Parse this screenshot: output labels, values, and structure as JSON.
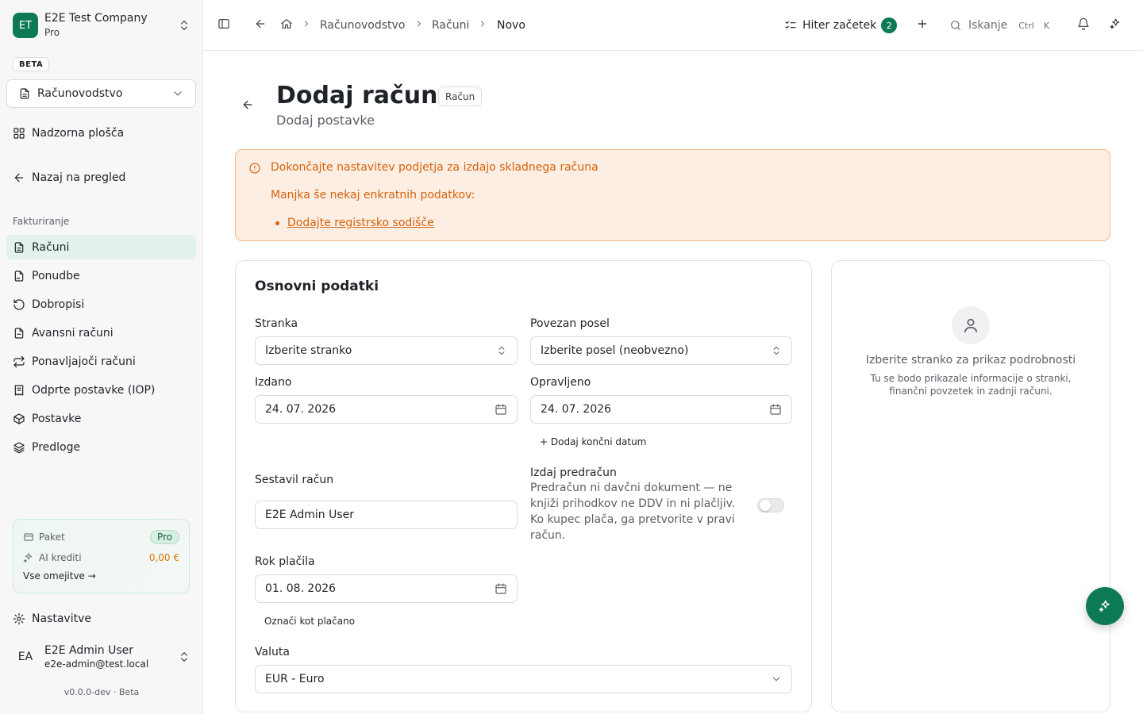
{
  "company": {
    "initials": "ET",
    "name": "E2E Test Company",
    "plan": "Pro"
  },
  "beta_label": "BETA",
  "module": {
    "selected": "Računovodstvo"
  },
  "nav": {
    "dashboard": "Nadzorna plošča",
    "back_overview": "Nazaj na pregled",
    "section": "Fakturiranje",
    "items": [
      {
        "label": "Računi",
        "icon": "file-text-icon"
      },
      {
        "label": "Ponudbe",
        "icon": "file-signature-icon"
      },
      {
        "label": "Dobropisi",
        "icon": "rotate-ccw-icon"
      },
      {
        "label": "Avansni računi",
        "icon": "file-minus-icon"
      },
      {
        "label": "Ponavljajoči računi",
        "icon": "repeat-icon"
      },
      {
        "label": "Odprte postavke (IOP)",
        "icon": "receipt-icon"
      },
      {
        "label": "Postavke",
        "icon": "package-icon"
      },
      {
        "label": "Predloge",
        "icon": "layers-icon"
      }
    ],
    "settings": "Nastavitve"
  },
  "plan_card": {
    "plan_label": "Paket",
    "plan_value": "Pro",
    "credits_label": "AI krediti",
    "credits_value": "0,00 €",
    "limits_link": "Vse omejitve →"
  },
  "user": {
    "initials": "EA",
    "name": "E2E Admin User",
    "email": "e2e-admin@test.local"
  },
  "version": "v0.0.0-dev · Beta",
  "breadcrumb": [
    "Računovodstvo",
    "Računi",
    "Novo"
  ],
  "topbar": {
    "quick_start": "Hiter začetek",
    "quick_start_count": "2",
    "search_label": "Iskanje",
    "kbd_ctrl": "Ctrl",
    "kbd_k": "K"
  },
  "page": {
    "title": "Dodaj račun",
    "badge": "Račun",
    "subtitle": "Dodaj postavke"
  },
  "alert": {
    "title": "Dokončajte nastavitev podjetja za izdajo skladnega računa",
    "text": "Manjka še nekaj enkratnih podatkov:",
    "link": "Dodajte registrsko sodišče"
  },
  "form": {
    "title": "Osnovni podatki",
    "customer_label": "Stranka",
    "customer_placeholder": "Izberite stranko",
    "deal_label": "Povezan posel",
    "deal_placeholder": "Izberite posel (neobvezno)",
    "issued_label": "Izdano",
    "issued_value": "24. 07. 2026",
    "performed_label": "Opravljeno",
    "performed_value": "24. 07. 2026",
    "add_end_date": "+ Dodaj končni datum",
    "author_label": "Sestavil račun",
    "author_value": "E2E Admin User",
    "proforma_label": "Izdaj predračun",
    "proforma_help": "Predračun ni davčni dokument — ne knjiži prihodkov ne DDV in ni plačljiv. Ko kupec plača, ga pretvorite v pravi račun.",
    "proforma_enabled": false,
    "due_label": "Rok plačila",
    "due_value": "01. 08. 2026",
    "mark_paid": "Označi kot plačano",
    "currency_label": "Valuta",
    "currency_value": "EUR - Euro"
  },
  "side_panel": {
    "title": "Izberite stranko za prikaz podrobnosti",
    "description": "Tu se bodo prikazale informacije o stranki, finančni povzetek in zadnji računi."
  },
  "colors": {
    "brand": "#0e7a55",
    "alert_text": "#d4620a",
    "alert_bg": "#fdeee4",
    "active_nav": "#e3f3ec",
    "credits": "#d97706"
  }
}
